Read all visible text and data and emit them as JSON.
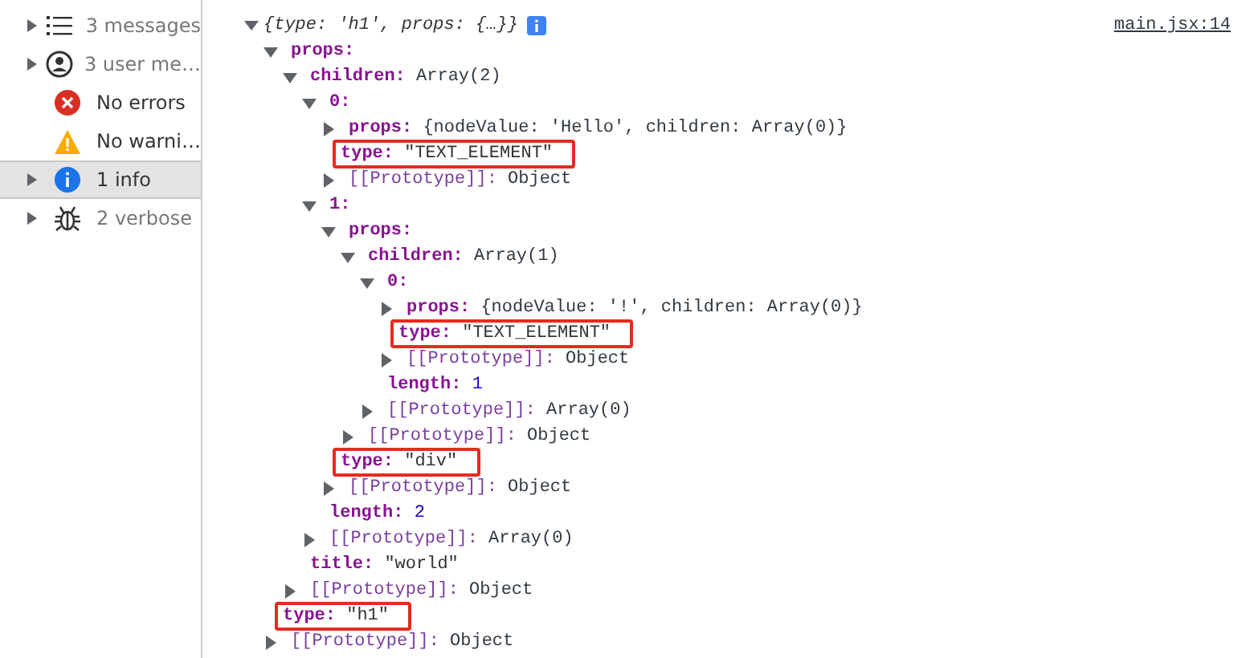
{
  "sidebar": {
    "items": [
      {
        "kind": "messages",
        "label": "3 messages",
        "expandable": true,
        "selected": false
      },
      {
        "kind": "user",
        "label": "3 user me…",
        "expandable": true,
        "selected": false
      },
      {
        "kind": "error",
        "label": "No errors",
        "expandable": false,
        "selected": false
      },
      {
        "kind": "warning",
        "label": "No warni…",
        "expandable": false,
        "selected": false
      },
      {
        "kind": "info",
        "label": "1 info",
        "expandable": true,
        "selected": true
      },
      {
        "kind": "verbose",
        "label": "2 verbose",
        "expandable": true,
        "selected": false
      }
    ]
  },
  "console": {
    "root": {
      "preview": "{type: 'h1', props: {…}}",
      "source": "main.jsx:14",
      "expanded": true,
      "children": [
        {
          "key": "props:",
          "kind": "group",
          "expanded": true,
          "highlighted": false,
          "children": [
            {
              "key": "children:",
              "value": "Array(2)",
              "kind": "object",
              "expanded": true,
              "highlighted": false,
              "children": [
                {
                  "key": "0:",
                  "kind": "group",
                  "expanded": true,
                  "highlighted": false,
                  "children": [
                    {
                      "key": "props:",
                      "value": "{nodeValue: 'Hello', children: Array(0)}",
                      "kind": "object",
                      "expanded": false,
                      "highlighted": false
                    },
                    {
                      "key": "type:",
                      "value": "\"TEXT_ELEMENT\"",
                      "kind": "string",
                      "highlighted": true
                    },
                    {
                      "key": "[[Prototype]]:",
                      "value": "Object",
                      "kind": "internal",
                      "expanded": false,
                      "highlighted": false
                    }
                  ]
                },
                {
                  "key": "1:",
                  "kind": "group",
                  "expanded": true,
                  "highlighted": false,
                  "children": [
                    {
                      "key": "props:",
                      "kind": "group",
                      "expanded": true,
                      "highlighted": false,
                      "children": [
                        {
                          "key": "children:",
                          "value": "Array(1)",
                          "kind": "object",
                          "expanded": true,
                          "highlighted": false,
                          "children": [
                            {
                              "key": "0:",
                              "kind": "group",
                              "expanded": true,
                              "highlighted": false,
                              "children": [
                                {
                                  "key": "props:",
                                  "value": "{nodeValue: '!', children: Array(0)}",
                                  "kind": "object",
                                  "expanded": false,
                                  "highlighted": false
                                },
                                {
                                  "key": "type:",
                                  "value": "\"TEXT_ELEMENT\"",
                                  "kind": "string",
                                  "highlighted": true
                                },
                                {
                                  "key": "[[Prototype]]:",
                                  "value": "Object",
                                  "kind": "internal",
                                  "expanded": false,
                                  "highlighted": false
                                }
                              ]
                            },
                            {
                              "key": "length:",
                              "value": "1",
                              "kind": "number",
                              "highlighted": false
                            },
                            {
                              "key": "[[Prototype]]:",
                              "value": "Array(0)",
                              "kind": "internal",
                              "expanded": false,
                              "highlighted": false
                            }
                          ]
                        },
                        {
                          "key": "[[Prototype]]:",
                          "value": "Object",
                          "kind": "internal",
                          "expanded": false,
                          "highlighted": false
                        }
                      ]
                    },
                    {
                      "key": "type:",
                      "value": "\"div\"",
                      "kind": "string",
                      "highlighted": true
                    },
                    {
                      "key": "[[Prototype]]:",
                      "value": "Object",
                      "kind": "internal",
                      "expanded": false,
                      "highlighted": false
                    }
                  ]
                },
                {
                  "key": "length:",
                  "value": "2",
                  "kind": "number",
                  "highlighted": false
                },
                {
                  "key": "[[Prototype]]:",
                  "value": "Array(0)",
                  "kind": "internal",
                  "expanded": false,
                  "highlighted": false
                }
              ]
            },
            {
              "key": "title:",
              "value": "\"world\"",
              "kind": "string",
              "highlighted": false
            },
            {
              "key": "[[Prototype]]:",
              "value": "Object",
              "kind": "internal",
              "expanded": false,
              "highlighted": false
            }
          ]
        },
        {
          "key": "type:",
          "value": "\"h1\"",
          "kind": "string",
          "highlighted": true
        },
        {
          "key": "[[Prototype]]:",
          "value": "Object",
          "kind": "internal",
          "expanded": false,
          "highlighted": false
        }
      ]
    }
  }
}
